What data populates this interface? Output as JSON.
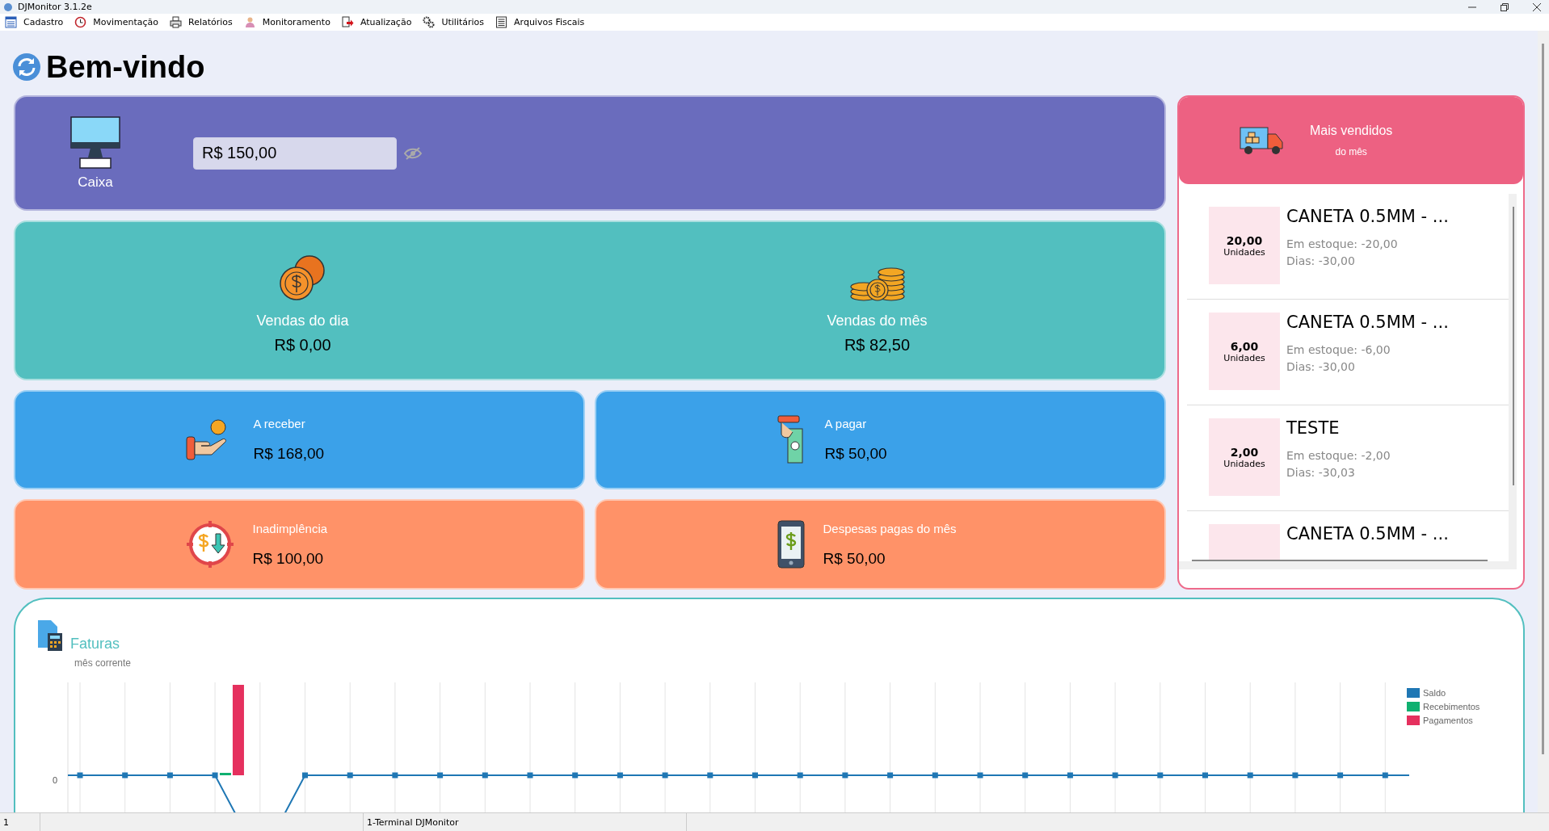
{
  "window": {
    "title": "DJMonitor 3.1.2e"
  },
  "menu": [
    {
      "label": "Cadastro",
      "kind": "list"
    },
    {
      "label": "Movimentação",
      "kind": "clock"
    },
    {
      "label": "Relatórios",
      "kind": "printer"
    },
    {
      "label": "Monitoramento",
      "kind": "person"
    },
    {
      "label": "Atualização",
      "kind": "update"
    },
    {
      "label": "Utilitários",
      "kind": "gears"
    },
    {
      "label": "Arquivos Fiscais",
      "kind": "doc"
    }
  ],
  "header": {
    "title": "Bem-vindo"
  },
  "caixa": {
    "label": "Caixa",
    "value": "R$ 150,00"
  },
  "sales": [
    {
      "label": "Vendas do dia",
      "value": "R$ 0,00",
      "kind": "coins"
    },
    {
      "label": "Vendas do mês",
      "value": "R$ 82,50",
      "kind": "stack"
    }
  ],
  "cards": [
    {
      "label": "A receber",
      "value": "R$ 168,00",
      "kind": "receive"
    },
    {
      "label": "A pagar",
      "value": "R$ 50,00",
      "kind": "pay"
    },
    {
      "label": "Inadimplência",
      "value": "R$ 100,00",
      "kind": "default"
    },
    {
      "label": "Despesas pagas do mês",
      "value": "R$ 50,00",
      "kind": "expenses"
    }
  ],
  "top_sellers": {
    "title": "Mais vendidos",
    "subtitle": "do mês",
    "items": [
      {
        "qty": "20,00",
        "unit": "Unidades",
        "name": "CANETA 0.5MM - ...",
        "stock": "Em estoque: -20,00",
        "days": "Dias: -30,00"
      },
      {
        "qty": "6,00",
        "unit": "Unidades",
        "name": "CANETA 0.5MM - ...",
        "stock": "Em estoque: -6,00",
        "days": "Dias: -30,00"
      },
      {
        "qty": "2,00",
        "unit": "Unidades",
        "name": "TESTE",
        "stock": "Em estoque: -2,00",
        "days": "Dias: -30,03"
      },
      {
        "name": "CANETA 0.5MM - ..."
      }
    ]
  },
  "invoices": {
    "title": "Faturas",
    "subtitle": "mês corrente",
    "y_tick": "0",
    "legend": [
      {
        "name": "Saldo",
        "color": "#1f77b4"
      },
      {
        "name": "Recebimentos",
        "color": "#10b070"
      },
      {
        "name": "Pagamentos",
        "color": "#e5305e"
      }
    ]
  },
  "status_bar": [
    "1",
    "1-Terminal DJMonitor"
  ]
}
